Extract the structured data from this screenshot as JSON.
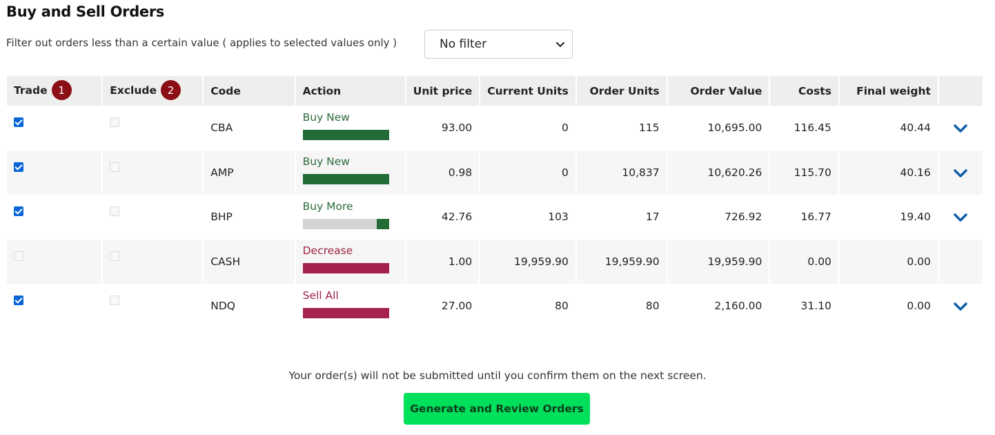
{
  "page": {
    "title": "Buy and Sell Orders",
    "filter_label": "Filter out orders less than a certain value ( applies to selected values only )",
    "filter_value": "No filter"
  },
  "table": {
    "headers": {
      "trade": "Trade",
      "trade_badge": "1",
      "exclude": "Exclude",
      "exclude_badge": "2",
      "code": "Code",
      "action": "Action",
      "unit_price": "Unit price",
      "current_units": "Current Units",
      "order_units": "Order Units",
      "order_value": "Order Value",
      "costs": "Costs",
      "final_weight": "Final weight"
    },
    "rows": [
      {
        "trade": true,
        "exclude": false,
        "code": "CBA",
        "action": "Buy New",
        "action_type": "buy",
        "action_progress": 1.0,
        "unit_price": "93.00",
        "current_units": "0",
        "order_units": "115",
        "order_value": "10,695.00",
        "costs": "116.45",
        "final_weight": "40.44",
        "expandable": true
      },
      {
        "trade": true,
        "exclude": false,
        "code": "AMP",
        "action": "Buy New",
        "action_type": "buy",
        "action_progress": 1.0,
        "unit_price": "0.98",
        "current_units": "0",
        "order_units": "10,837",
        "order_value": "10,620.26",
        "costs": "115.70",
        "final_weight": "40.16",
        "expandable": true
      },
      {
        "trade": true,
        "exclude": false,
        "code": "BHP",
        "action": "Buy More",
        "action_type": "buy",
        "action_progress": 0.14,
        "unit_price": "42.76",
        "current_units": "103",
        "order_units": "17",
        "order_value": "726.92",
        "costs": "16.77",
        "final_weight": "19.40",
        "expandable": true
      },
      {
        "trade": false,
        "exclude": false,
        "code": "CASH",
        "action": "Decrease",
        "action_type": "sell",
        "action_progress": 1.0,
        "unit_price": "1.00",
        "current_units": "19,959.90",
        "order_units": "19,959.90",
        "order_value": "19,959.90",
        "costs": "0.00",
        "final_weight": "0.00",
        "expandable": false
      },
      {
        "trade": true,
        "exclude": false,
        "code": "NDQ",
        "action": "Sell All",
        "action_type": "sell",
        "action_progress": 1.0,
        "unit_price": "27.00",
        "current_units": "80",
        "order_units": "80",
        "order_value": "2,160.00",
        "costs": "31.10",
        "final_weight": "0.00",
        "expandable": true
      }
    ]
  },
  "footer": {
    "notice": "Your order(s) will not be submitted until you confirm them on the next screen.",
    "button_label": "Generate and Review Orders"
  },
  "colors": {
    "badge": "#8b0f14",
    "buy": "#236b37",
    "sell": "#a4224b",
    "checkbox": "#0a66d8",
    "chevron": "#0f5ea8",
    "primary_button": "#00e05a"
  }
}
